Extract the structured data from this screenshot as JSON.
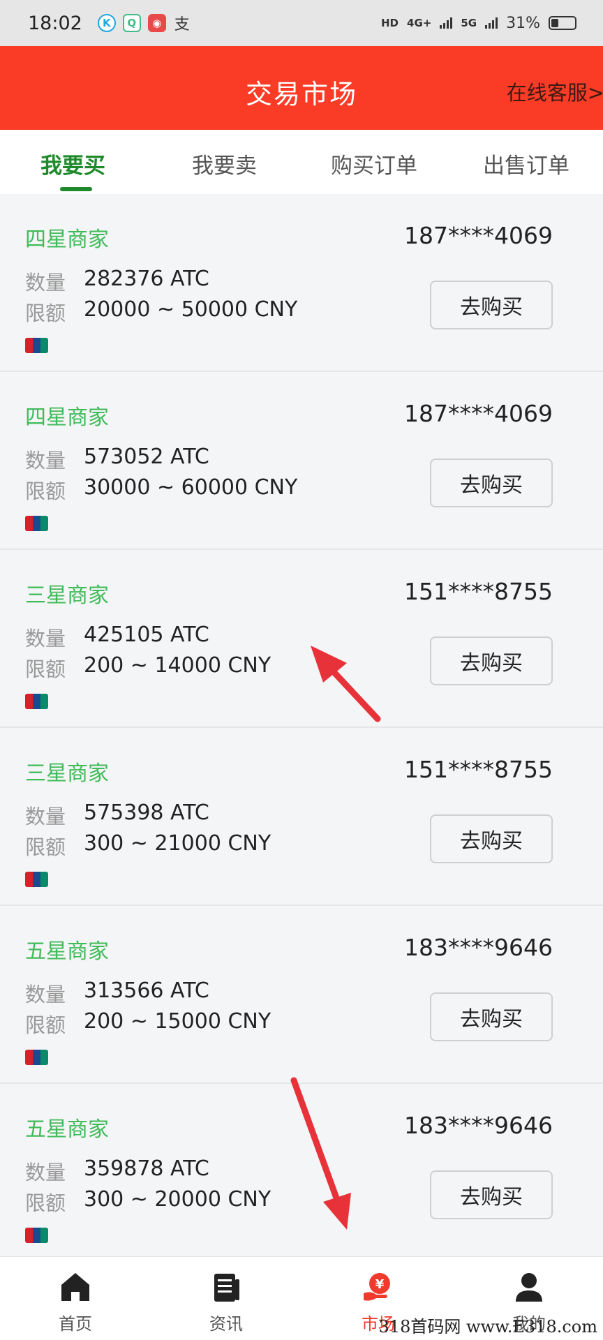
{
  "status_bar": {
    "time": "18:02",
    "hd_label": "HD",
    "network_1": "4G+",
    "network_2": "5G",
    "battery": "31%",
    "battery_level": 0.31,
    "app_icons": [
      "k-app-icon",
      "chat-app-icon",
      "red-app-icon",
      "alipay-icon"
    ]
  },
  "header": {
    "title": "交易市场",
    "support_link": "在线客服>"
  },
  "tabs": [
    {
      "label": "我要买",
      "active": true
    },
    {
      "label": "我要卖",
      "active": false
    },
    {
      "label": "购买订单",
      "active": false
    },
    {
      "label": "出售订单",
      "active": false
    }
  ],
  "list_labels": {
    "quantity": "数量",
    "limit": "限额",
    "buy_button": "去购买"
  },
  "offers": [
    {
      "merchant": "四星商家",
      "phone": "187****4069",
      "quantity": "282376 ATC",
      "limit": "20000 ~ 50000 CNY"
    },
    {
      "merchant": "四星商家",
      "phone": "187****4069",
      "quantity": "573052 ATC",
      "limit": "30000 ~ 60000 CNY"
    },
    {
      "merchant": "三星商家",
      "phone": "151****8755",
      "quantity": "425105 ATC",
      "limit": "200 ~ 14000 CNY"
    },
    {
      "merchant": "三星商家",
      "phone": "151****8755",
      "quantity": "575398 ATC",
      "limit": "300 ~ 21000 CNY"
    },
    {
      "merchant": "五星商家",
      "phone": "183****9646",
      "quantity": "313566 ATC",
      "limit": "200 ~ 15000 CNY"
    },
    {
      "merchant": "五星商家",
      "phone": "183****9646",
      "quantity": "359878 ATC",
      "limit": "300 ~ 20000 CNY"
    }
  ],
  "bottom_nav": [
    {
      "label": "首页",
      "icon": "home-icon",
      "active": false
    },
    {
      "label": "资讯",
      "icon": "news-icon",
      "active": false
    },
    {
      "label": "市场",
      "icon": "market-icon",
      "active": true
    },
    {
      "label": "我的",
      "icon": "profile-icon",
      "active": false
    }
  ],
  "watermark": "318首码网 www.E318.com",
  "colors": {
    "header": "#fa3b26",
    "active_tab": "#1e8a2c",
    "merchant": "#3fbb57",
    "annotation_arrow": "#e8323a",
    "nav_active": "#f03a2e"
  }
}
